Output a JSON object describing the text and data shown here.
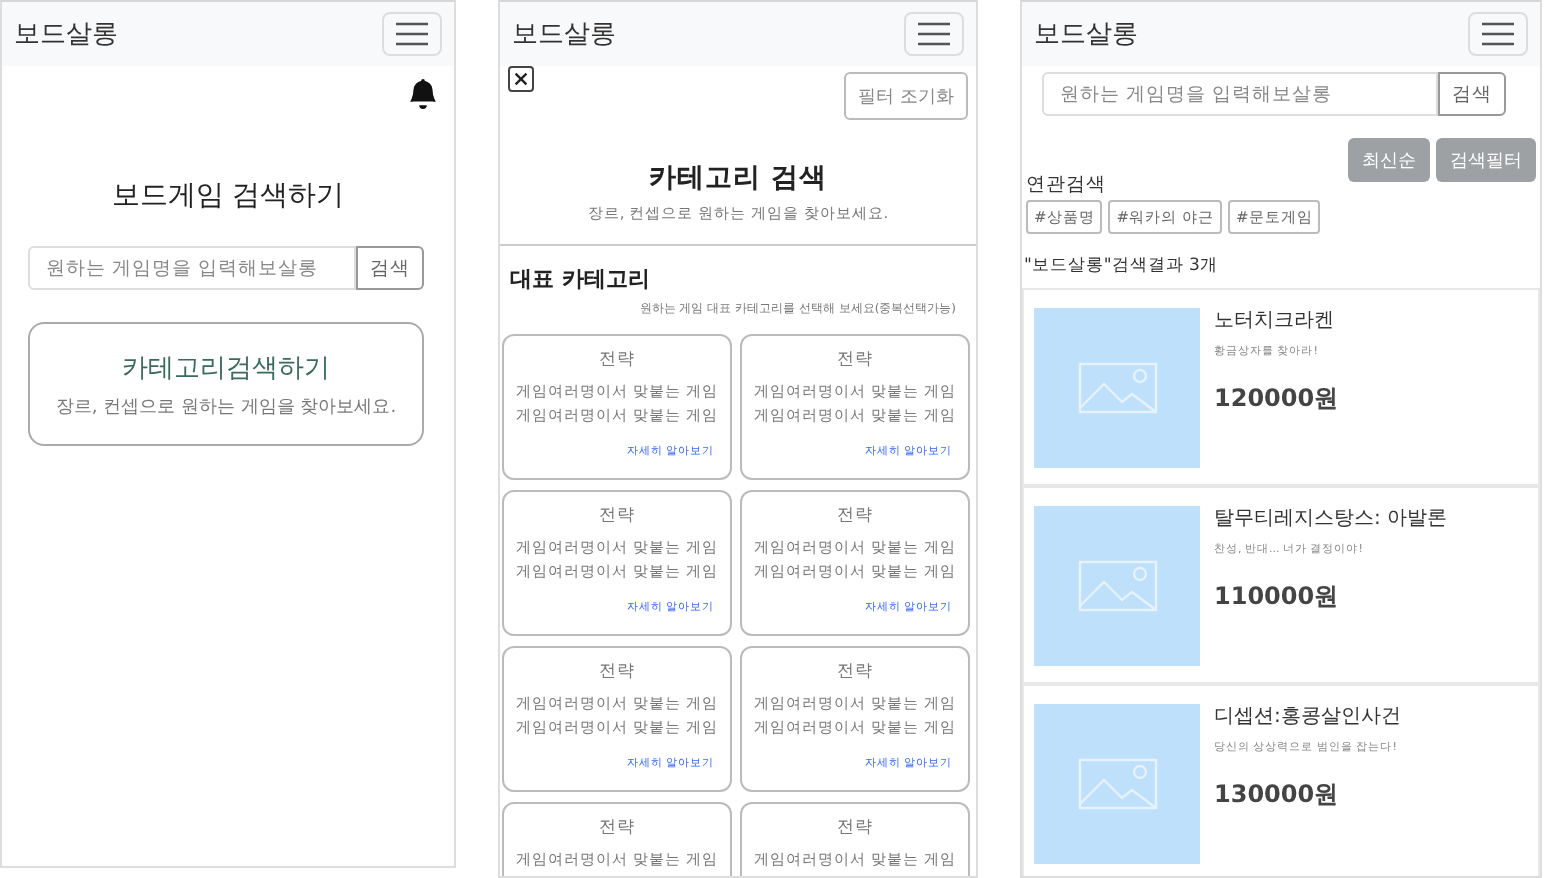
{
  "screens": [
    {
      "brand": "보드살롱",
      "kind": "home",
      "title": "보드게임 검색하기",
      "search": {
        "placeholder": "원하는 게임명을 입력해보살롱",
        "button": "검색"
      },
      "category_card": {
        "title": "카테고리검색하기",
        "subtitle": "장르, 컨셉으로 원하는 게임을 찾아보세요."
      }
    },
    {
      "brand": "보드살롱",
      "kind": "category",
      "reset_button": "필터 조기화",
      "title": "카테고리 검색",
      "subtitle": "장르, 컨셉으로 원하는 게임을 찾아보세요.",
      "section_title": "대표 카테고리",
      "section_hint": "원하는 게임 대표 카테고리를 선택해 보세요(중복선택가능)",
      "cards": [
        {
          "title": "전략",
          "lines": [
            "게임여러명이서 맞붙는 게임",
            "게임여러명이서 맞붙는 게임"
          ],
          "link": "자세히 알아보기"
        },
        {
          "title": "전략",
          "lines": [
            "게임여러명이서 맞붙는 게임",
            "게임여러명이서 맞붙는 게임"
          ],
          "link": "자세히 알아보기"
        },
        {
          "title": "전략",
          "lines": [
            "게임여러명이서 맞붙는 게임",
            "게임여러명이서 맞붙는 게임"
          ],
          "link": "자세히 알아보기"
        },
        {
          "title": "전략",
          "lines": [
            "게임여러명이서 맞붙는 게임",
            "게임여러명이서 맞붙는 게임"
          ],
          "link": "자세히 알아보기"
        },
        {
          "title": "전략",
          "lines": [
            "게임여러명이서 맞붙는 게임",
            "게임여러명이서 맞붙는 게임"
          ],
          "link": "자세히 알아보기"
        },
        {
          "title": "전략",
          "lines": [
            "게임여러명이서 맞붙는 게임",
            "게임여러명이서 맞붙는 게임"
          ],
          "link": "자세히 알아보기"
        },
        {
          "title": "전략",
          "lines": [
            "게임여러명이서 맞붙는 게임"
          ]
        },
        {
          "title": "전략",
          "lines": [
            "게임여러명이서 맞붙는 게임"
          ]
        }
      ]
    },
    {
      "brand": "보드살롱",
      "kind": "results",
      "search": {
        "placeholder": "원하는 게임명을 입력해보살롱",
        "button": "검색"
      },
      "sort_buttons": [
        "최신순",
        "검색필터"
      ],
      "related_label": "연관검색",
      "tags": [
        "#상품명",
        "#워카의 야근",
        "#문토게임"
      ],
      "result_count": "\"보드살롱\"검색결과 3개",
      "results": [
        {
          "name": "노터치크라켄",
          "description": "황금상자를 찾아라!",
          "price": "120000원"
        },
        {
          "name": "탈무티레지스탕스: 아발론",
          "description": "찬성, 반대... 너가 결정이야!",
          "price": "110000원"
        },
        {
          "name": "디셉션:홍콩살인사건",
          "description": "당신의 상상력으로 범인을 잡는다!",
          "price": "130000원"
        }
      ]
    }
  ]
}
